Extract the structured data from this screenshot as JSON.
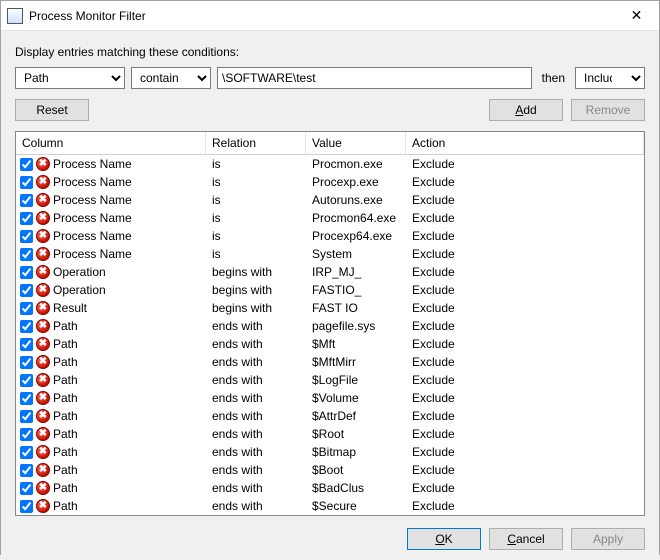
{
  "title": "Process Monitor Filter",
  "instruction": "Display entries matching these conditions:",
  "filter": {
    "column": "Path",
    "relation": "contains",
    "value": "\\SOFTWARE\\test",
    "then_label": "then",
    "action": "Include"
  },
  "buttons": {
    "reset": "Reset",
    "add": "Add",
    "remove": "Remove",
    "ok": "OK",
    "cancel": "Cancel",
    "apply": "Apply"
  },
  "columns": {
    "column": "Column",
    "relation": "Relation",
    "value": "Value",
    "action": "Action"
  },
  "rules": [
    {
      "checked": true,
      "column": "Process Name",
      "relation": "is",
      "value": "Procmon.exe",
      "action": "Exclude"
    },
    {
      "checked": true,
      "column": "Process Name",
      "relation": "is",
      "value": "Procexp.exe",
      "action": "Exclude"
    },
    {
      "checked": true,
      "column": "Process Name",
      "relation": "is",
      "value": "Autoruns.exe",
      "action": "Exclude"
    },
    {
      "checked": true,
      "column": "Process Name",
      "relation": "is",
      "value": "Procmon64.exe",
      "action": "Exclude"
    },
    {
      "checked": true,
      "column": "Process Name",
      "relation": "is",
      "value": "Procexp64.exe",
      "action": "Exclude"
    },
    {
      "checked": true,
      "column": "Process Name",
      "relation": "is",
      "value": "System",
      "action": "Exclude"
    },
    {
      "checked": true,
      "column": "Operation",
      "relation": "begins with",
      "value": "IRP_MJ_",
      "action": "Exclude"
    },
    {
      "checked": true,
      "column": "Operation",
      "relation": "begins with",
      "value": "FASTIO_",
      "action": "Exclude"
    },
    {
      "checked": true,
      "column": "Result",
      "relation": "begins with",
      "value": "FAST IO",
      "action": "Exclude"
    },
    {
      "checked": true,
      "column": "Path",
      "relation": "ends with",
      "value": "pagefile.sys",
      "action": "Exclude"
    },
    {
      "checked": true,
      "column": "Path",
      "relation": "ends with",
      "value": "$Mft",
      "action": "Exclude"
    },
    {
      "checked": true,
      "column": "Path",
      "relation": "ends with",
      "value": "$MftMirr",
      "action": "Exclude"
    },
    {
      "checked": true,
      "column": "Path",
      "relation": "ends with",
      "value": "$LogFile",
      "action": "Exclude"
    },
    {
      "checked": true,
      "column": "Path",
      "relation": "ends with",
      "value": "$Volume",
      "action": "Exclude"
    },
    {
      "checked": true,
      "column": "Path",
      "relation": "ends with",
      "value": "$AttrDef",
      "action": "Exclude"
    },
    {
      "checked": true,
      "column": "Path",
      "relation": "ends with",
      "value": "$Root",
      "action": "Exclude"
    },
    {
      "checked": true,
      "column": "Path",
      "relation": "ends with",
      "value": "$Bitmap",
      "action": "Exclude"
    },
    {
      "checked": true,
      "column": "Path",
      "relation": "ends with",
      "value": "$Boot",
      "action": "Exclude"
    },
    {
      "checked": true,
      "column": "Path",
      "relation": "ends with",
      "value": "$BadClus",
      "action": "Exclude"
    },
    {
      "checked": true,
      "column": "Path",
      "relation": "ends with",
      "value": "$Secure",
      "action": "Exclude"
    }
  ]
}
